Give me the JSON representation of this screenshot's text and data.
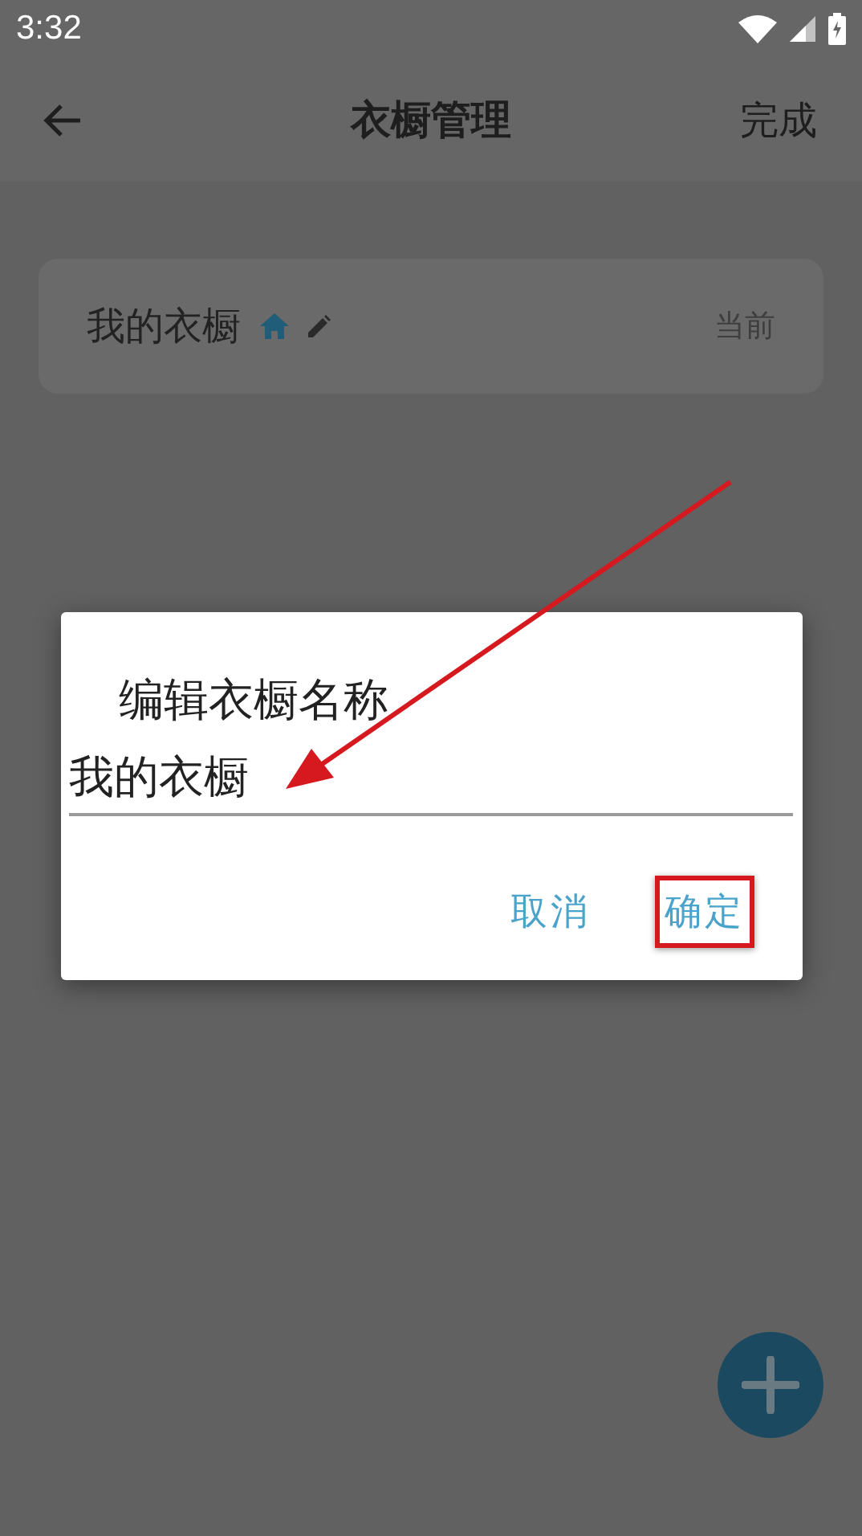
{
  "status_bar": {
    "time": "3:32"
  },
  "app_bar": {
    "title": "衣橱管理",
    "action": "完成"
  },
  "wardrobes": [
    {
      "name": "我的衣橱",
      "badge": "当前",
      "is_default": true
    }
  ],
  "dialog": {
    "title": "编辑衣橱名称",
    "value": "我的衣橱",
    "actions": [
      {
        "label": "取消",
        "highlighted": false
      },
      {
        "label": "确定",
        "highlighted": true
      }
    ]
  }
}
